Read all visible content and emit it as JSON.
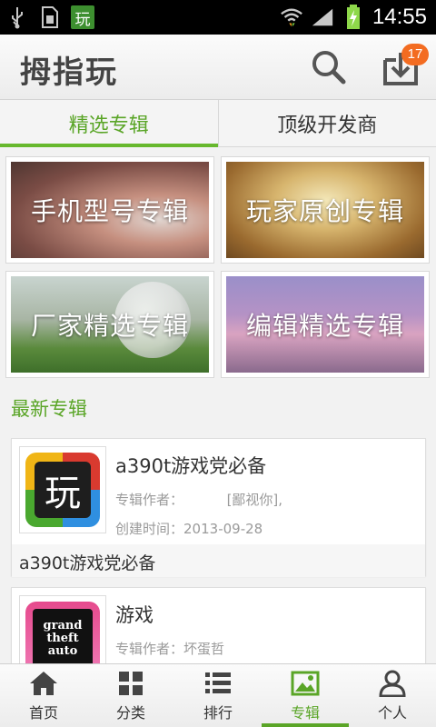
{
  "status_bar": {
    "icons": [
      "usb-icon",
      "sim-card-icon",
      "app-notification-icon",
      "wifi-icon",
      "signal-icon",
      "battery-charging-icon"
    ],
    "app_icon_char": "玩",
    "time": "14:55"
  },
  "header": {
    "title": "拇指玩",
    "download_badge": "17"
  },
  "tabs": [
    {
      "label": "精选专辑",
      "active": true
    },
    {
      "label": "顶级开发商",
      "active": false
    }
  ],
  "banners": [
    {
      "label": "手机型号专辑"
    },
    {
      "label": "玩家原创专辑"
    },
    {
      "label": "厂家精选专辑"
    },
    {
      "label": "编辑精选专辑"
    }
  ],
  "section": {
    "title": "最新专辑"
  },
  "albums": [
    {
      "title": "a390t游戏党必备",
      "author_label": "专辑作者：",
      "author": "[鄙视你],",
      "created_label": "创建时间：",
      "created": "2013-09-28",
      "description": "a390t游戏党必备",
      "thumb_char": "玩"
    },
    {
      "title": "游戏",
      "author_label": "专辑作者：",
      "author": "坏蛋哲",
      "thumb_text": "grand theft auto"
    }
  ],
  "bottom_nav": [
    {
      "label": "首页",
      "icon": "home-icon"
    },
    {
      "label": "分类",
      "icon": "grid-icon"
    },
    {
      "label": "排行",
      "icon": "list-icon"
    },
    {
      "label": "专辑",
      "icon": "album-image-icon",
      "active": true
    },
    {
      "label": "个人",
      "icon": "person-icon"
    }
  ],
  "colors": {
    "accent_green": "#5aa527",
    "badge_orange": "#f36c21"
  }
}
